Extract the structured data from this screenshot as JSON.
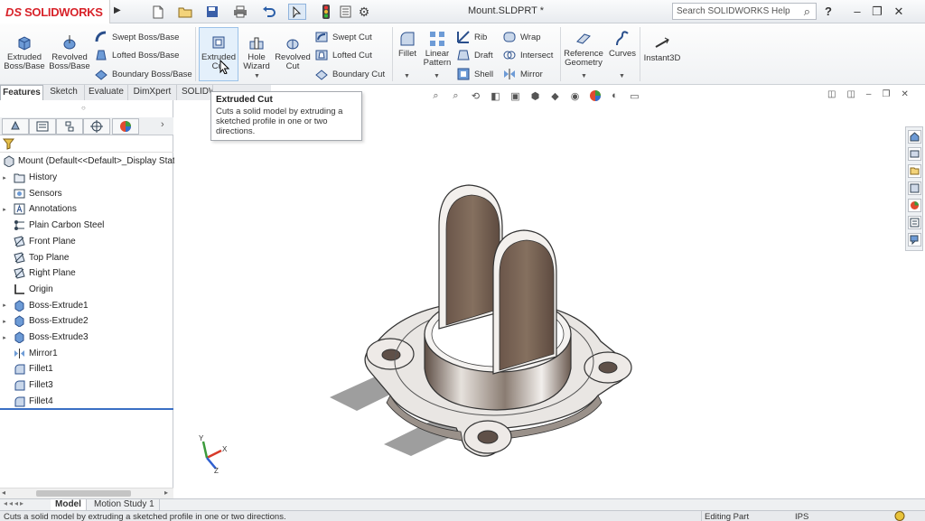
{
  "app": {
    "logo_ds": "DS",
    "logo_name": "SOLIDWORKS",
    "document_title": "Mount.SLDPRT *",
    "search_placeholder": "Search SOLIDWORKS Help",
    "help_label": "?"
  },
  "ribbon": {
    "extruded_boss": "Extruded Boss/Base",
    "revolved_boss": "Revolved Boss/Base",
    "swept_boss": "Swept Boss/Base",
    "lofted_boss": "Lofted Boss/Base",
    "boundary_boss": "Boundary Boss/Base",
    "extruded_cut": "Extruded Cut",
    "hole_wizard": "Hole Wizard",
    "revolved_cut": "Revolved Cut",
    "swept_cut": "Swept Cut",
    "lofted_cut": "Lofted Cut",
    "boundary_cut": "Boundary Cut",
    "fillet": "Fillet",
    "linear_pattern": "Linear Pattern",
    "rib": "Rib",
    "draft": "Draft",
    "shell": "Shell",
    "wrap": "Wrap",
    "intersect": "Intersect",
    "mirror": "Mirror",
    "reference_geometry": "Reference Geometry",
    "curves": "Curves",
    "instant3d": "Instant3D"
  },
  "tabs": [
    "Features",
    "Sketch",
    "Evaluate",
    "DimXpert",
    "SOLIDW"
  ],
  "tooltip": {
    "title": "Extruded Cut",
    "description": "Cuts a solid model by extruding a sketched profile in one or two directions."
  },
  "tree": {
    "root": "Mount  (Default<<Default>_Display State",
    "items": [
      {
        "label": "History",
        "icon": "history-icon"
      },
      {
        "label": "Sensors",
        "icon": "sensor-icon"
      },
      {
        "label": "Annotations",
        "icon": "annotations-icon"
      },
      {
        "label": "Plain Carbon Steel",
        "icon": "material-icon"
      },
      {
        "label": "Front Plane",
        "icon": "plane-icon"
      },
      {
        "label": "Top Plane",
        "icon": "plane-icon"
      },
      {
        "label": "Right Plane",
        "icon": "plane-icon"
      },
      {
        "label": "Origin",
        "icon": "origin-icon"
      },
      {
        "label": "Boss-Extrude1",
        "icon": "extrude-icon"
      },
      {
        "label": "Boss-Extrude2",
        "icon": "extrude-icon"
      },
      {
        "label": "Boss-Extrude3",
        "icon": "extrude-icon"
      },
      {
        "label": "Mirror1",
        "icon": "mirror-icon"
      },
      {
        "label": "Fillet1",
        "icon": "fillet-icon"
      },
      {
        "label": "Fillet3",
        "icon": "fillet-icon"
      },
      {
        "label": "Fillet4",
        "icon": "fillet-icon"
      }
    ]
  },
  "bottom_tabs": [
    "Model",
    "Motion Study 1"
  ],
  "status": {
    "message": "Cuts a solid model by extruding a sketched profile in one or two directions.",
    "mode": "Editing Part",
    "units": "IPS"
  },
  "axis_labels": {
    "x": "X",
    "y": "Y",
    "z": "Z"
  },
  "colors": {
    "brand": "#d8232a",
    "selection": "#3a6fc4",
    "fin": "#7a6558"
  }
}
